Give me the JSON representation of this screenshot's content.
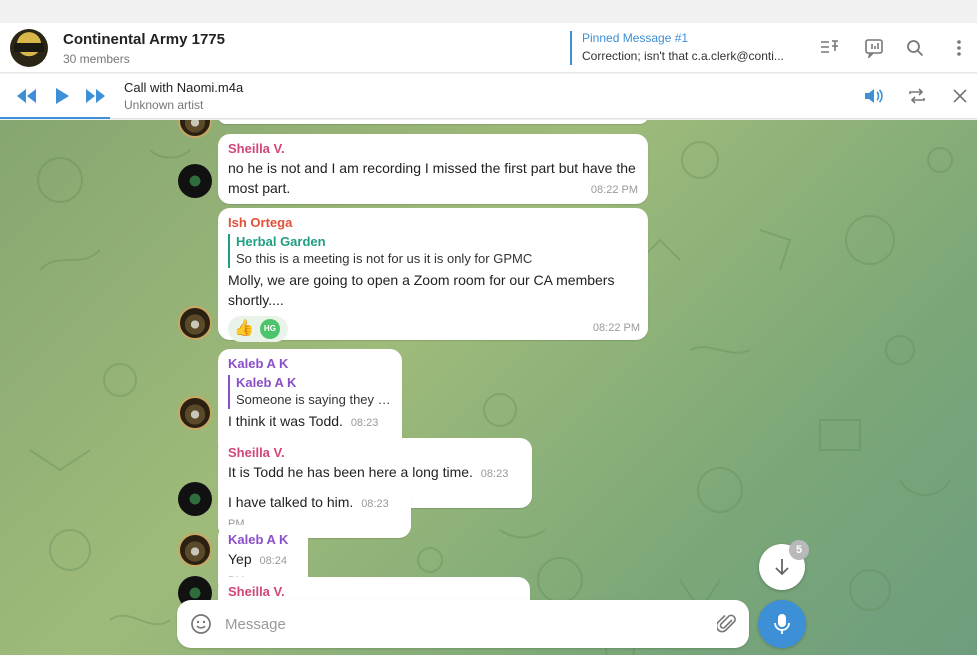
{
  "header": {
    "title": "Continental Army 1775",
    "members": "30 members",
    "pinned_title": "Pinned Message #1",
    "pinned_text": "Correction; isn't that c.a.clerk@conti...",
    "icons": [
      "pinned-list-icon",
      "video-chat-icon",
      "search-icon",
      "more-vertical-icon"
    ]
  },
  "player": {
    "track_title": "Call with Naomi.m4a",
    "track_artist": "Unknown artist",
    "icons": [
      "rewind-icon",
      "play-icon",
      "fast-forward-icon",
      "volume-icon",
      "repeat-icon",
      "close-icon"
    ]
  },
  "messages": [
    {
      "sender": "Sheilla V.",
      "text": "no he is not and I am recording I missed the first part but have the most part.",
      "time": "08:22 PM"
    },
    {
      "sender": "Ish Ortega",
      "reply_name": "Herbal Garden",
      "reply_text": "So this is a meeting is not for us it is only for GPMC",
      "text": "Molly, we are going to open a Zoom room for our CA members shortly....",
      "reaction_emoji": "👍",
      "reaction_user": "HG",
      "time": "08:22 PM"
    },
    {
      "sender": "Kaleb A K",
      "reply_name": "Kaleb A K",
      "reply_text": "Someone is saying they ha...",
      "text": "I think it was Todd.",
      "time": "08:23 PM"
    },
    {
      "sender": "Sheilla V.",
      "text": "It is Todd he has been here a long time.",
      "time": "08:23 PM"
    },
    {
      "text": "I have talked to him.",
      "time": "08:23 PM"
    },
    {
      "sender": "Kaleb A K",
      "text": "Yep",
      "time": "08:24 PM"
    },
    {
      "sender": "Sheilla V."
    }
  ],
  "scroll_down": {
    "badge": "5"
  },
  "composer": {
    "placeholder": "Message"
  },
  "colors": {
    "accent": "#3d8fd6",
    "sheilla": "#d2457a",
    "ish": "#e0513a",
    "herbal": "#1f9e83",
    "kaleb": "#8a4fc7"
  }
}
